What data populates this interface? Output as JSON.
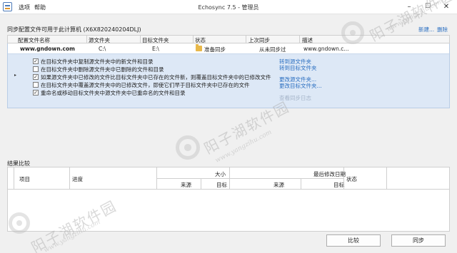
{
  "titlebar": {
    "menu": [
      "选项",
      "帮助"
    ],
    "title": "Echosync 7.5 - 管理员",
    "buttons": {
      "minimize": "–",
      "maximize": "☐",
      "close": "✕"
    }
  },
  "sync_config": {
    "heading": "同步配置文件可用于此计算机 (X6X820240204DLJ)",
    "new_link": "新建...",
    "delete_link": "删除",
    "columns": [
      "配置文件名称",
      "源文件夹",
      "目标文件夹",
      "状态",
      "上次同步",
      "描述"
    ],
    "job": {
      "name": "www.gndown.com",
      "source": "C:\\",
      "target": "E:\\",
      "status": "准备同步",
      "last_sync": "从未同步过",
      "description": "www.gndown.c..."
    },
    "options": [
      {
        "checked": true,
        "label": "在目标文件夹中复制源文件夹中的新文件和目录"
      },
      {
        "checked": false,
        "label": "在目标文件夹中删除源文件夹中已删除的文件和目录"
      },
      {
        "checked": true,
        "label": "如果源文件夹中已修改的文件比目标文件夹中已存在的文件新，则覆盖目标文件夹中的已修改文件"
      },
      {
        "checked": false,
        "label": "在目标文件夹中覆盖源文件夹中的已修改文件，即使它们早于目标文件夹中已存在的文件"
      },
      {
        "checked": true,
        "label": "重命名或移动目标文件夹中源文件夹中已重命名的文件和目录"
      }
    ],
    "action_links": [
      "转到源文件夹",
      "转到目标文件夹",
      "更改源文件夹...",
      "更改目标文件夹...",
      "查看同步日志"
    ]
  },
  "results": {
    "heading": "结果比较",
    "columns": {
      "item": "项目",
      "progress": "进度",
      "size": "大小",
      "modified": "最后修改日期",
      "status": "状态",
      "source": "来源",
      "target": "目标"
    }
  },
  "buttons": {
    "compare": "比较",
    "sync": "同步"
  },
  "watermark": {
    "text": "阳子湖软件园",
    "url": "www.yangzihu.com"
  },
  "colors": {
    "accent": "#2b6fc1",
    "selection": "#dde8f6"
  }
}
